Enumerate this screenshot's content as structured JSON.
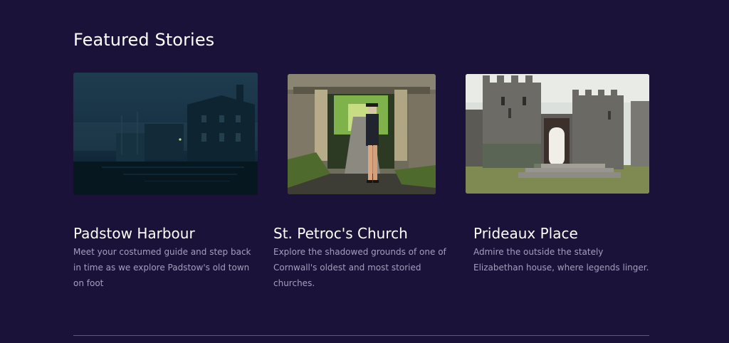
{
  "section": {
    "title": "Featured Stories"
  },
  "stories": [
    {
      "title": "Padstow Harbour",
      "description": "Meet your costumed guide and step back in time as we explore Padstow's old town on foot",
      "image_icon": "harbour-night-photo"
    },
    {
      "title": "St. Petroc's Church",
      "description": "Explore the shadowed grounds of one of Cornwall's oldest and most storied churches.",
      "image_icon": "church-lychgate-guide-photo"
    },
    {
      "title": "Prideaux Place",
      "description": "Admire the outside the stately Elizabethan house, where legends linger.",
      "image_icon": "castle-gatehouse-photo"
    }
  ],
  "colors": {
    "background": "#1a1238",
    "title": "#ffffff",
    "description": "#a49fbe",
    "divider": "#5e587a"
  }
}
